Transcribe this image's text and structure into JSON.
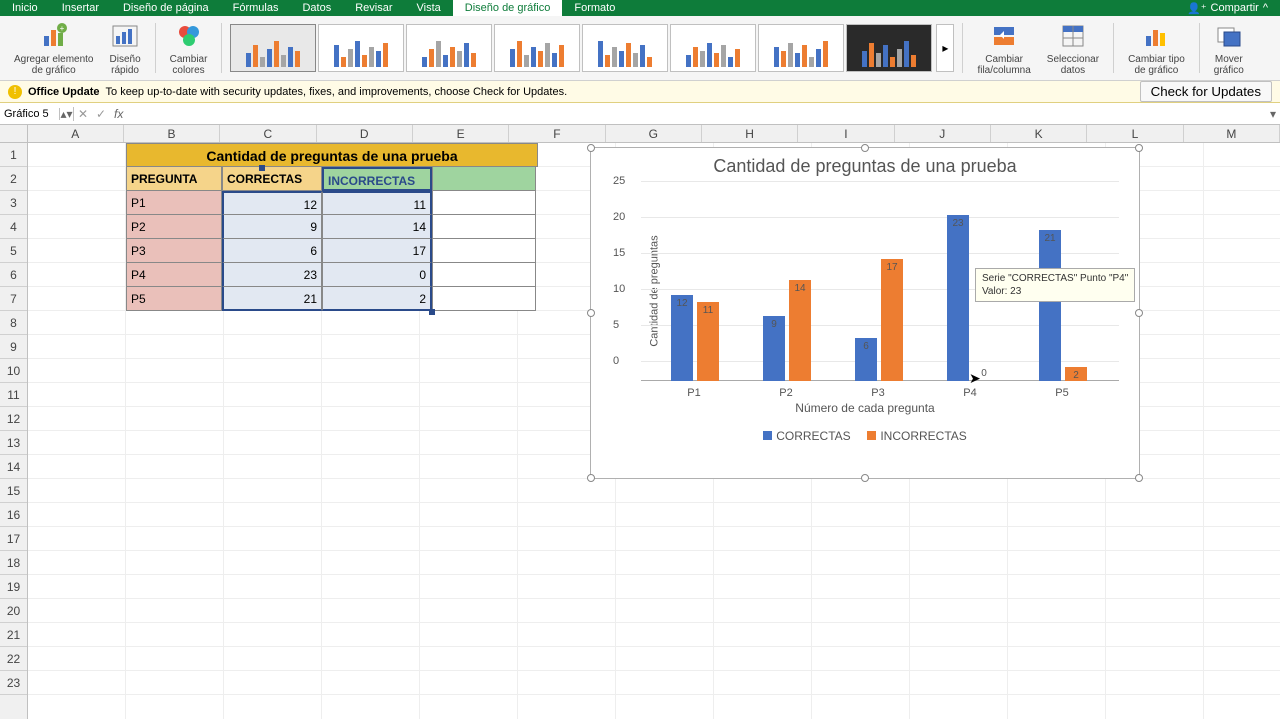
{
  "ribbon": {
    "tabs": [
      "Inicio",
      "Insertar",
      "Diseño de página",
      "Fórmulas",
      "Datos",
      "Revisar",
      "Vista",
      "Diseño de gráfico",
      "Formato"
    ],
    "active": "Diseño de gráfico",
    "share": "Compartir",
    "groups": {
      "add_element": "Agregar elemento\nde gráfico",
      "quick_layout": "Diseño\nrápido",
      "change_colors": "Cambiar\ncolores",
      "switch_rc": "Cambiar\nfila/columna",
      "select_data": "Seleccionar\ndatos",
      "change_type": "Cambiar tipo\nde gráfico",
      "move_chart": "Mover\ngráfico"
    }
  },
  "update_bar": {
    "title": "Office Update",
    "msg": "To keep up-to-date with security updates, fixes, and improvements, choose Check for Updates.",
    "btn": "Check for Updates"
  },
  "formula_bar": {
    "name_box": "Gráfico 5",
    "fx": "fx"
  },
  "columns": [
    "A",
    "B",
    "C",
    "D",
    "E",
    "F",
    "G",
    "H",
    "I",
    "J",
    "K",
    "L",
    "M"
  ],
  "row_count": 23,
  "table": {
    "title": "Cantidad de preguntas de una prueba",
    "headers": {
      "p": "PREGUNTA",
      "c": "CORRECTAS",
      "i": "INCORRECTAS"
    },
    "rows": [
      {
        "p": "P1",
        "c": 12,
        "i": 11
      },
      {
        "p": "P2",
        "c": 9,
        "i": 14
      },
      {
        "p": "P3",
        "c": 6,
        "i": 17
      },
      {
        "p": "P4",
        "c": 23,
        "i": 0
      },
      {
        "p": "P5",
        "c": 21,
        "i": 2
      }
    ]
  },
  "chart_data": {
    "type": "bar",
    "title": "Cantidad de preguntas de una prueba",
    "xlabel": "Número de cada pregunta",
    "ylabel": "Cantidad de preguntas",
    "categories": [
      "P1",
      "P2",
      "P3",
      "P4",
      "P5"
    ],
    "series": [
      {
        "name": "CORRECTAS",
        "values": [
          12,
          9,
          6,
          23,
          21
        ],
        "color": "#4472c4"
      },
      {
        "name": "INCORRECTAS",
        "values": [
          11,
          14,
          17,
          0,
          2
        ],
        "color": "#ed7d31"
      }
    ],
    "ylim": [
      0,
      25
    ],
    "yticks": [
      0,
      5,
      10,
      15,
      20,
      25
    ],
    "tooltip": {
      "line1": "Serie \"CORRECTAS\" Punto \"P4\"",
      "line2": "Valor: 23"
    }
  }
}
